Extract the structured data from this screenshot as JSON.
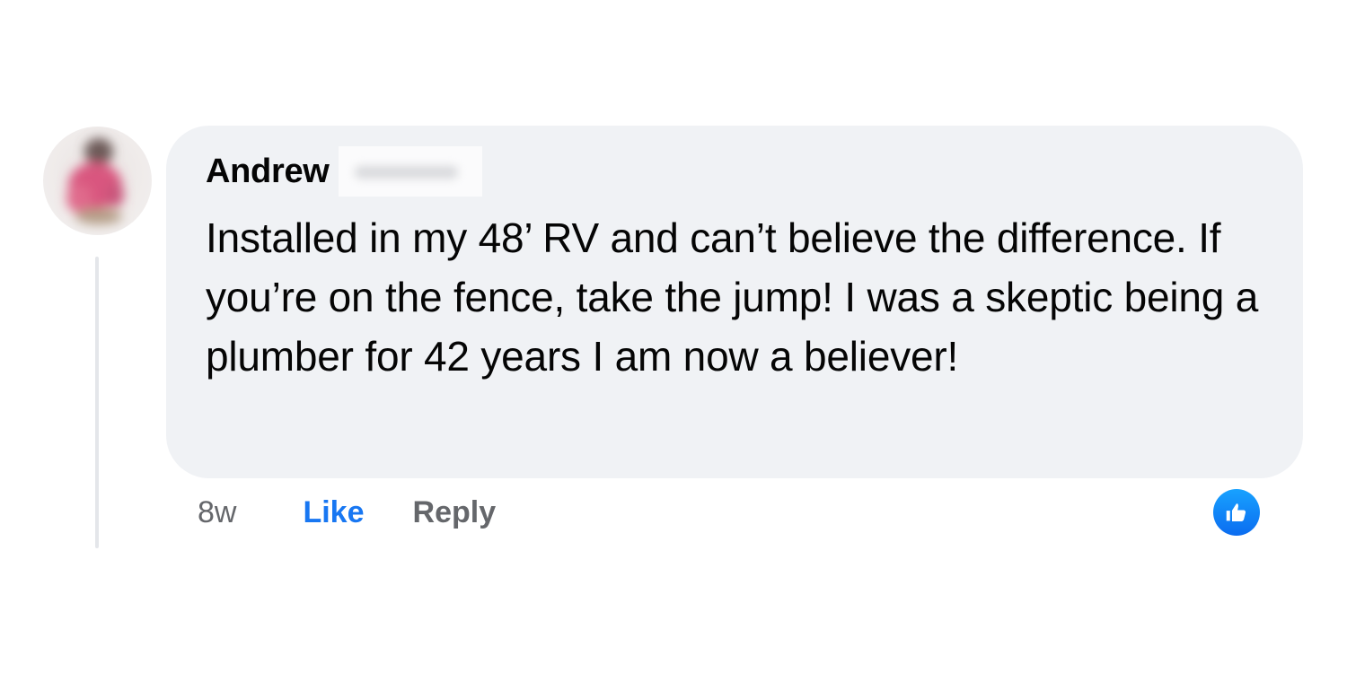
{
  "comment": {
    "author_first_name": "Andrew",
    "text": "Installed in my 48’ RV and can’t believe the difference. If you’re on the fence, take the jump! I was a skeptic being a plumber for 42 years I am now a believer!",
    "timestamp": "8w",
    "like_label": "Like",
    "reply_label": "Reply",
    "reaction": {
      "icon": "thumbs-up-icon",
      "color": "#1877f2"
    }
  },
  "colors": {
    "bubble": "#f0f2f5",
    "text": "#050505",
    "muted": "#65676b",
    "accent": "#1877f2"
  }
}
